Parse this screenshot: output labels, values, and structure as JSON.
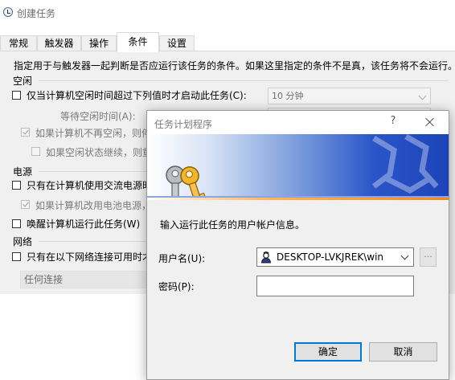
{
  "window": {
    "title": "创建任务"
  },
  "tabs": [
    {
      "label": "常规"
    },
    {
      "label": "触发器"
    },
    {
      "label": "操作"
    },
    {
      "label": "条件",
      "active": true
    },
    {
      "label": "设置"
    }
  ],
  "conditions": {
    "description": "指定用于与触发器一起判断是否应运行该任务的条件。如果这里指定的条件不是真，该任务将不会运行。",
    "idle": {
      "section": "空闲",
      "start_if_idle": "仅当计算机空闲时间超过下列值时才启动此任务(C):",
      "idle_duration_value": "10 分钟",
      "wait_for_idle": "等待空闲时间(A):",
      "stop_if_not_idle": "如果计算机不再空闲，则停",
      "restart_if_idle_resumes": "如果空闲状态继续，则重"
    },
    "power": {
      "section": "电源",
      "start_on_ac": "只有在计算机使用交流电源时",
      "stop_on_battery": "如果计算机改用电池电源，",
      "wake_to_run": "唤醒计算机运行此任务(W)"
    },
    "network": {
      "section": "网络",
      "start_if_network": "只有在以下网络连接可用时才",
      "network_value": "任何连接"
    }
  },
  "dialog": {
    "title": "任务计划程序",
    "help_label": "?",
    "prompt": "输入运行此任务的用户帐户信息。",
    "username_label": "用户名(U):",
    "username_value": "DESKTOP-LVKJREK\\win",
    "password_label": "密码(P):",
    "password_value": "",
    "browse_label": "...",
    "ok_label": "确定",
    "cancel_label": "取消"
  },
  "icons": {
    "window_icon": "task-scheduler-clock-icon",
    "banner_icon": "keys-icon",
    "user_icon": "user-account-icon"
  },
  "colors": {
    "banner_blue": "#1c44b8",
    "banner_orange": "#f08a1c",
    "ok_border": "#0078d7"
  }
}
